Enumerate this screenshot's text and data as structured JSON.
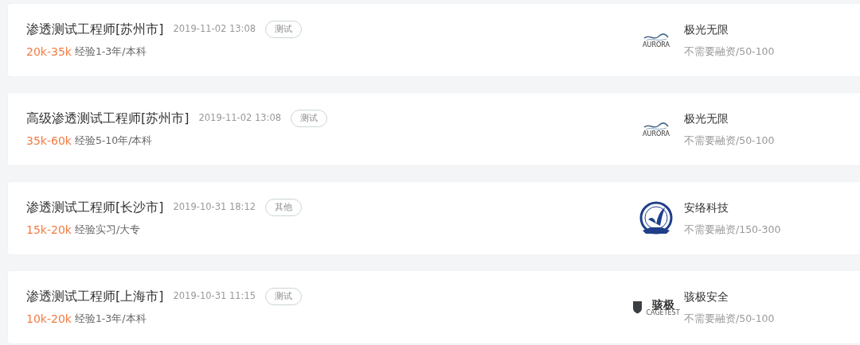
{
  "jobs": [
    {
      "title": "渗透测试工程师[苏州市]",
      "time": "2019-11-02 13:08",
      "tag": "测试",
      "salary": "20k-35k",
      "requirement": "经验1-3年/本科",
      "company": {
        "name": "极光无限",
        "info": "不需要融资/50-100",
        "logo": {
          "kind": "aurora",
          "text": "AURORA"
        }
      }
    },
    {
      "title": "高级渗透测试工程师[苏州市]",
      "time": "2019-11-02 13:08",
      "tag": "测试",
      "salary": "35k-60k",
      "requirement": "经验5-10年/本科",
      "company": {
        "name": "极光无限",
        "info": "不需要融资/50-100",
        "logo": {
          "kind": "aurora",
          "text": "AURORA"
        }
      }
    },
    {
      "title": "渗透测试工程师[长沙市]",
      "time": "2019-10-31 18:12",
      "tag": "其他",
      "salary": "15k-20k",
      "requirement": "经验实习/大专",
      "company": {
        "name": "安络科技",
        "info": "不需要融资/150-300",
        "logo": {
          "kind": "emblem"
        }
      }
    },
    {
      "title": "渗透测试工程师[上海市]",
      "time": "2019-10-31 11:15",
      "tag": "测试",
      "salary": "10k-20k",
      "requirement": "经验1-3年/本科",
      "company": {
        "name": "骇极安全",
        "info": "不需要融资/50-100",
        "logo": {
          "kind": "shield",
          "text": "骇极",
          "subtext": "CAGETEST"
        }
      }
    }
  ]
}
